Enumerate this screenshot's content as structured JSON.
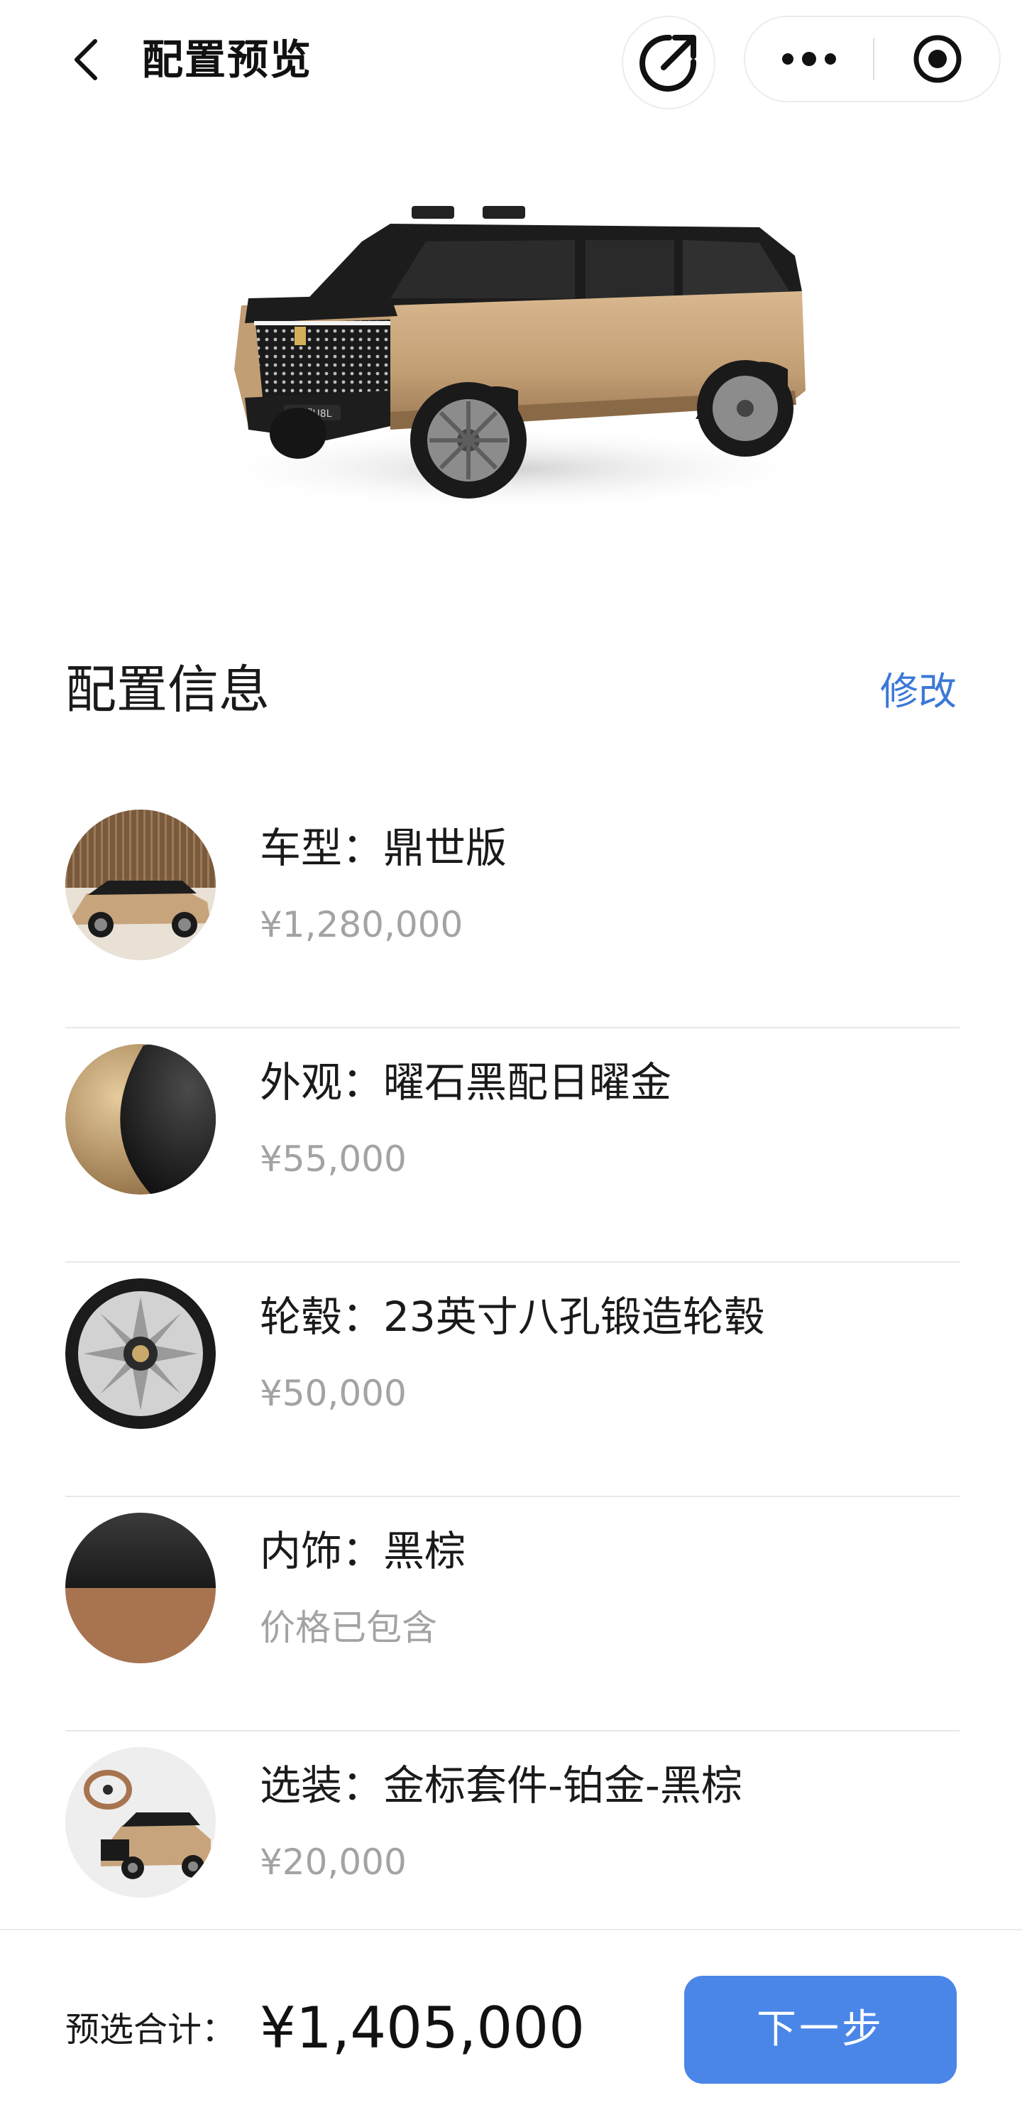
{
  "header": {
    "title": "配置预览",
    "back_icon": "chevron-left-icon",
    "share_icon": "share-arrow-icon",
    "more_icon": "more-dots-icon",
    "close_icon": "target-close-icon"
  },
  "hero": {
    "plate_text": "仰望U8L",
    "body_color": "#c7a47c",
    "roof_color": "#1c1c1c"
  },
  "config": {
    "title": "配置信息",
    "edit_label": "修改",
    "items": [
      {
        "label": "车型：鼎世版",
        "price": "¥1,280,000",
        "thumb": "vehicle-side-thumb"
      },
      {
        "label": "外观：曜石黑配日曜金",
        "price": "¥55,000",
        "thumb": "exterior-color-swatch"
      },
      {
        "label": "轮毂：23英寸八孔锻造轮毂",
        "price": "¥50,000",
        "thumb": "wheel-thumb"
      },
      {
        "label": "内饰：黑棕",
        "price": "价格已包含",
        "thumb": "interior-color-swatch"
      },
      {
        "label": "选装：金标套件-铂金-黑棕",
        "price": "¥20,000",
        "thumb": "option-package-thumb"
      }
    ]
  },
  "footer": {
    "total_label": "预选合计：",
    "total_value": "¥1,405,000",
    "next_label": "下一步"
  },
  "colors": {
    "accent": "#4a86e8",
    "link": "#3b78d8",
    "muted_text": "#a3a3a3",
    "gold": "#c7a47c",
    "black": "#1c1c1c",
    "interior_brown": "#a7744f"
  }
}
